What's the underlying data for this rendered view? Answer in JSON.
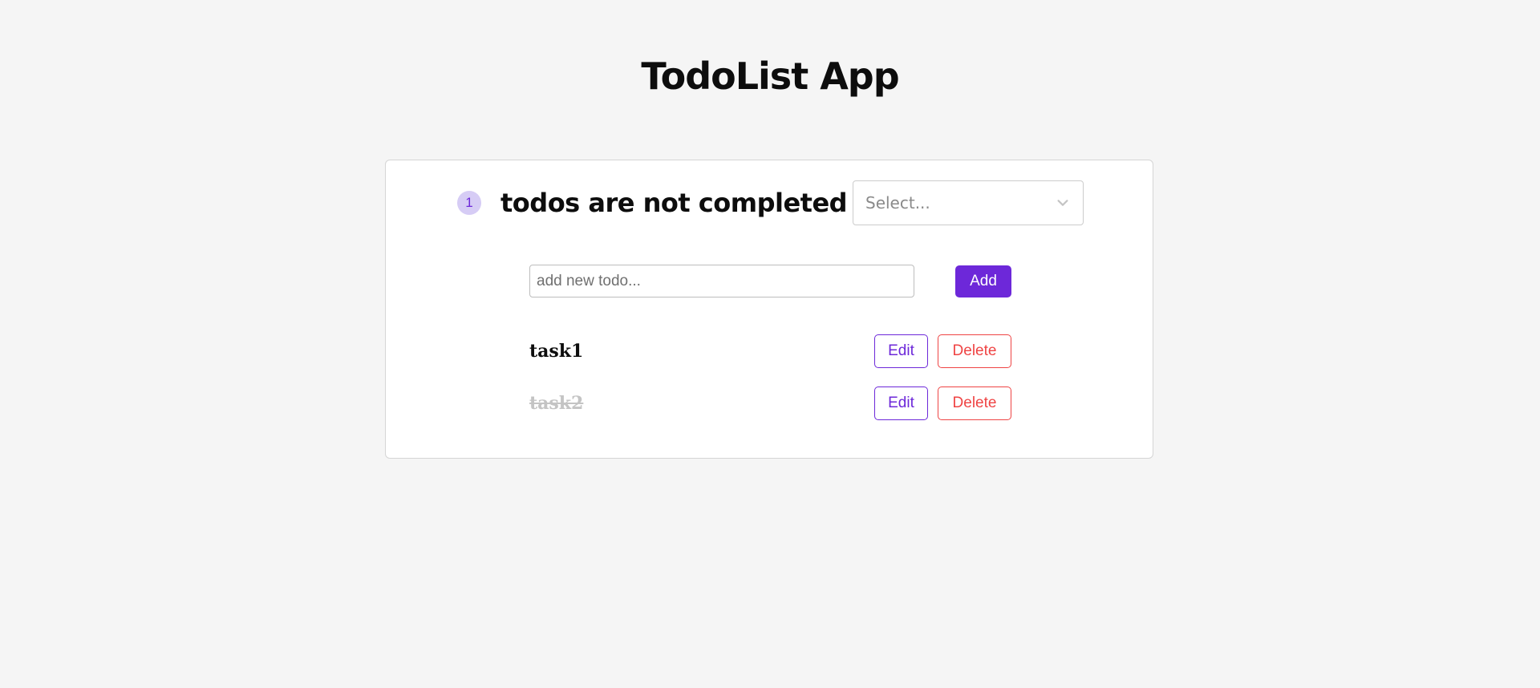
{
  "header": {
    "title": "TodoList App"
  },
  "summary": {
    "incomplete_count": "1",
    "status_text": "todos are not completed"
  },
  "filter": {
    "placeholder": "Select..."
  },
  "new_todo": {
    "placeholder": "add new todo...",
    "value": "",
    "add_label": "Add"
  },
  "todos": [
    {
      "text": "task1",
      "completed": false,
      "edit_label": "Edit",
      "delete_label": "Delete"
    },
    {
      "text": "task2",
      "completed": true,
      "edit_label": "Edit",
      "delete_label": "Delete"
    }
  ],
  "colors": {
    "background": "#f5f5f5",
    "accent": "#6d28d9",
    "badge_bg": "#d6ccf5",
    "danger": "#ef4444",
    "completed_text": "#c4c4c4"
  },
  "icons": {
    "filter_chevron": "chevron-down-icon"
  }
}
